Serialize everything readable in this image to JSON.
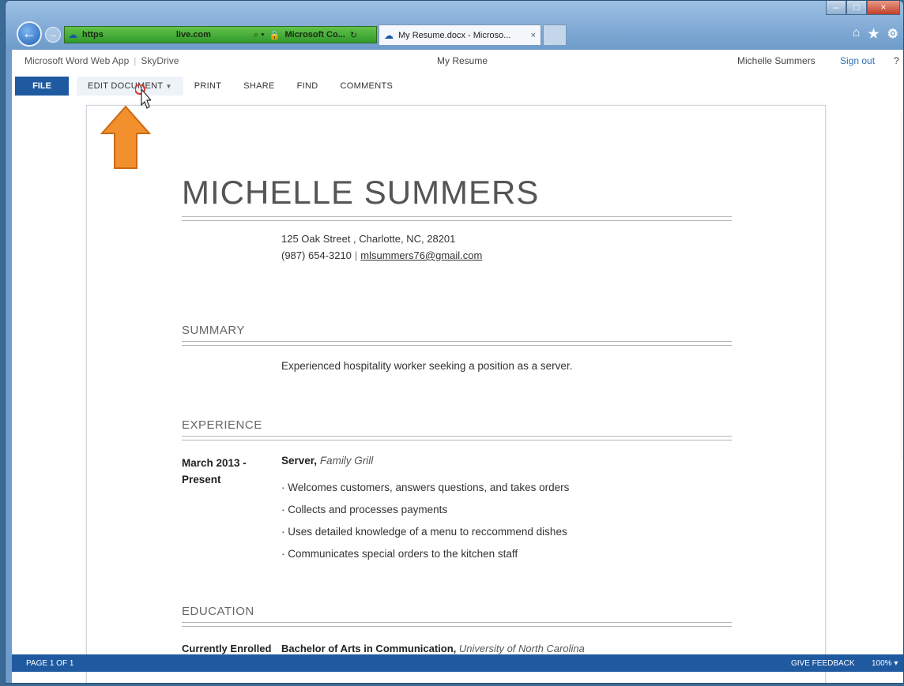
{
  "browser": {
    "address_prefix": "https",
    "address_domain": "live.com",
    "site_badge": "Microsoft Co...",
    "active_tab_title": "My Resume.docx - Microso...",
    "colors": {
      "address_bar": "#3aa533",
      "frame": "#7aa6d3"
    }
  },
  "app": {
    "name": "Microsoft Word Web App",
    "location": "SkyDrive",
    "doc_title": "My Resume",
    "user": "Michelle Summers",
    "signout": "Sign out",
    "help": "?"
  },
  "ribbon": {
    "file": "FILE",
    "tabs": [
      "EDIT DOCUMENT",
      "PRINT",
      "SHARE",
      "FIND",
      "COMMENTS"
    ],
    "accent": "#1f5aa0"
  },
  "resume": {
    "name": "MICHELLE SUMMERS",
    "address": "125 Oak Street , Charlotte, NC, 28201",
    "phone": "(987) 654-3210",
    "email": "mlsummers76@gmail.com",
    "sections": {
      "summary": {
        "title": "SUMMARY",
        "text": "Experienced hospitality worker seeking a position as a server."
      },
      "experience": {
        "title": "EXPERIENCE",
        "date_line1": "March 2013 -",
        "date_line2": "Present",
        "role": "Server,",
        "company": "Family Grill",
        "bullets": [
          "Welcomes customers, answers questions, and takes  orders",
          "Collects and processes payments",
          "Uses detailed knowledge of a menu to reccommend dishes",
          "Communicates special orders to the kitchen staff"
        ]
      },
      "education": {
        "title": "EDUCATION",
        "status": "Currently Enrolled",
        "degree": "Bachelor of Arts in Communication,",
        "school": "University  of North  Carolina"
      }
    }
  },
  "status": {
    "page": "PAGE 1 OF 1",
    "feedback": "GIVE FEEDBACK",
    "zoom": "100%"
  }
}
